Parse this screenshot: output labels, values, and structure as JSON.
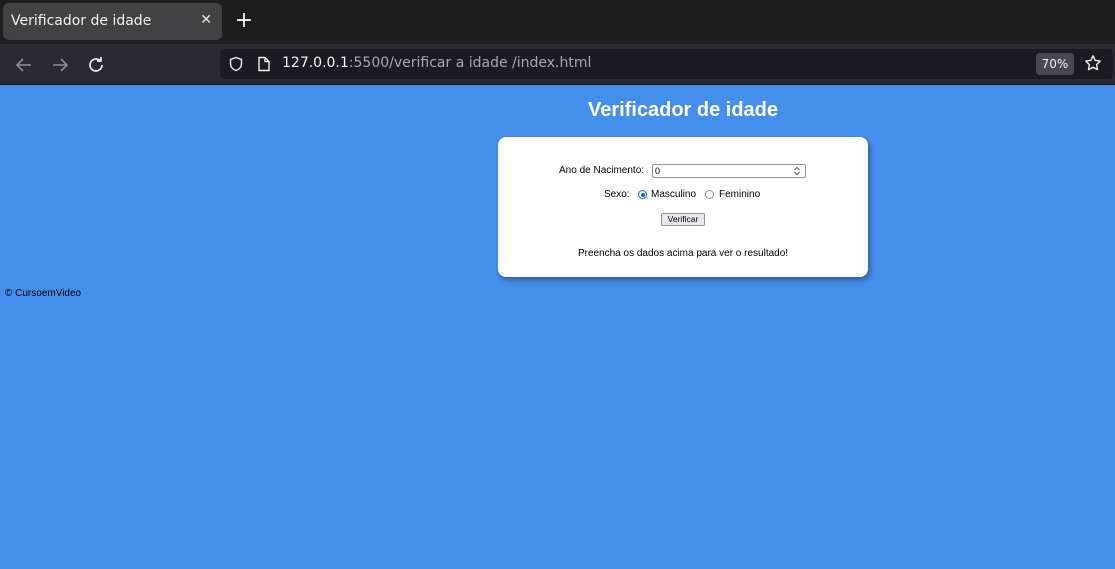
{
  "browser": {
    "tab_title": "Verificador de idade",
    "tab_close_icon": "close-icon",
    "new_tab_icon": "plus-icon",
    "nav_icons": [
      "back-arrow-icon",
      "forward-arrow-icon",
      "reload-icon"
    ],
    "url_host": "127.0.0.1",
    "url_rest": ":5500/verificar a idade /index.html",
    "zoom": "70%",
    "bookmark_icon": "star-icon"
  },
  "page": {
    "title": "Verificador de idade",
    "form": {
      "year_label": "Ano de Nacimento:",
      "year_value": "0",
      "sex_label": "Sexo:",
      "options": [
        "Masculino",
        "Feminino"
      ],
      "selected_option": "Masculino",
      "button_label": "Verificar"
    },
    "result_text": "Preencha os dados acima para ver o resultado!",
    "footer": "© CursoemVideo"
  },
  "colors": {
    "background": "#458fec",
    "card": "#ffffff",
    "title": "#ffffff"
  }
}
